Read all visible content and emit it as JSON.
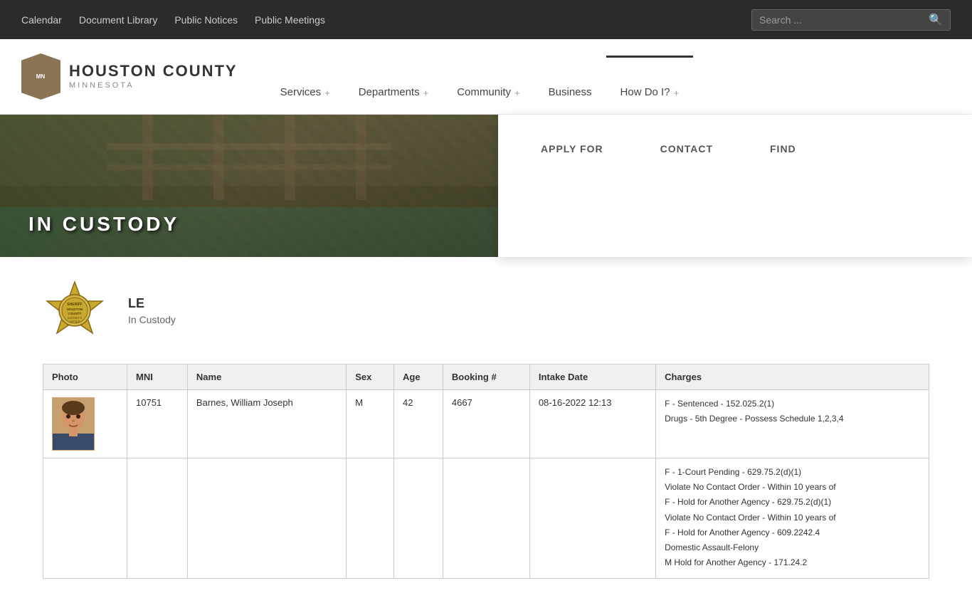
{
  "topbar": {
    "links": [
      {
        "label": "Calendar",
        "id": "calendar"
      },
      {
        "label": "Document Library",
        "id": "doc-library"
      },
      {
        "label": "Public Notices",
        "id": "public-notices"
      },
      {
        "label": "Public Meetings",
        "id": "public-meetings"
      }
    ],
    "search_placeholder": "Search ..."
  },
  "header": {
    "logo_text_line1": "HOUSTON COUNTY",
    "logo_text_line2": "MINNESOTA",
    "nav": [
      {
        "label": "Services",
        "plus": "+",
        "id": "services"
      },
      {
        "label": "Departments",
        "plus": "+",
        "id": "departments"
      },
      {
        "label": "Community",
        "plus": "+",
        "id": "community"
      },
      {
        "label": "Business",
        "plus": "",
        "id": "business"
      },
      {
        "label": "How Do I?",
        "plus": "+",
        "id": "how-do-i",
        "active": true
      }
    ]
  },
  "dropdown": {
    "sections": [
      {
        "heading": "APPLY FOR",
        "id": "apply-for",
        "items": []
      },
      {
        "heading": "CONTACT",
        "id": "contact",
        "items": []
      },
      {
        "heading": "FIND",
        "id": "find",
        "items": []
      }
    ]
  },
  "hero": {
    "title": "IN CUSTODY"
  },
  "badge": {
    "line1": "LE",
    "line2": "In Custody",
    "inner_text": "SHERIFF\nHOUSTON\nCOUNTY\nSHERIFF'S\nOFFICE"
  },
  "table": {
    "columns": [
      "Photo",
      "MNI",
      "Name",
      "Sex",
      "Age",
      "Booking #",
      "Intake Date",
      "Charges"
    ],
    "rows": [
      {
        "has_photo": true,
        "mni": "10751",
        "name": "Barnes, William Joseph",
        "sex": "M",
        "age": "42",
        "booking": "4667",
        "intake_date": "08-16-2022 12:13",
        "charges": [
          "F  -  Sentenced         -  152.025.2(1)",
          "Drugs - 5th Degree - Possess Schedule 1,2,3,4"
        ]
      },
      {
        "has_photo": false,
        "mni": "",
        "name": "",
        "sex": "",
        "age": "",
        "booking": "",
        "intake_date": "",
        "charges": [
          "F  -  1-Court Pending          -  629.75.2(d)(1)",
          "Violate No Contact Order - Within 10 years of",
          "F  -  Hold for Another Agency    -  629.75.2(d)(1)",
          "Violate No Contact Order - Within 10 years of",
          "F  -  Hold for Another Agency    -  609.2242.4",
          "Domestic Assault-Felony",
          "M  Hold for Another Agency     -  171.24.2"
        ]
      }
    ]
  }
}
